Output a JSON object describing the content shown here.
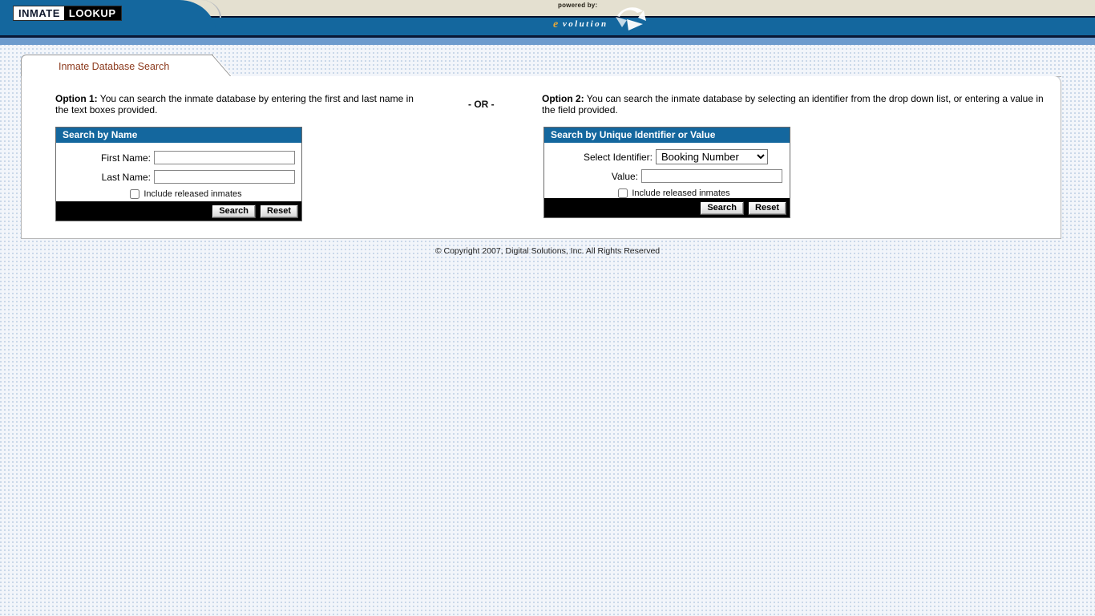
{
  "header": {
    "logo_part1": "INMATE",
    "logo_part2": "LOOKUP",
    "powered_by_label": "powered by:",
    "powered_by_brand_initial": "e",
    "powered_by_brand_rest": "volution",
    "compass_icon": "compass-arrow-icon"
  },
  "tab": {
    "label": "Inmate Database Search"
  },
  "intro": {
    "option1_bold": "Option 1:",
    "option1_text": " You can search the inmate database by entering the first and last name in the text boxes provided.",
    "option2_bold": "Option 2:",
    "option2_text": " You can search the inmate database by selecting an identifier from the drop down list, or entering a value in the field provided.",
    "separator": "- OR -"
  },
  "panel_name": {
    "title": "Search by Name",
    "first_name_label": "First Name:",
    "first_name_value": "",
    "last_name_label": "Last Name:",
    "last_name_value": "",
    "include_released_label": "Include released inmates",
    "include_released_checked": false,
    "search_button": "Search",
    "reset_button": "Reset"
  },
  "panel_identifier": {
    "title": "Search by Unique Identifier or Value",
    "select_identifier_label": "Select Identifier:",
    "select_identifier_selected": "Booking Number",
    "select_identifier_options": [
      "Booking Number"
    ],
    "value_label": "Value:",
    "value_value": "",
    "include_released_label": "Include released inmates",
    "include_released_checked": false,
    "search_button": "Search",
    "reset_button": "Reset",
    "dropdown_icon": "chevron-down-icon"
  },
  "footer": {
    "copyright": "© Copyright 2007, Digital Solutions, Inc. All Rights Reserved"
  },
  "colors": {
    "header_blue": "#14679e",
    "header_beige": "#e4e0d0",
    "header_navy": "#0a1835",
    "header_lightblue": "#6d9bcd",
    "panel_header_blue": "#14679e",
    "tab_text": "#8c3a1d",
    "brand_gold": "#e8a838",
    "page_bg": "#f2f5fa"
  }
}
